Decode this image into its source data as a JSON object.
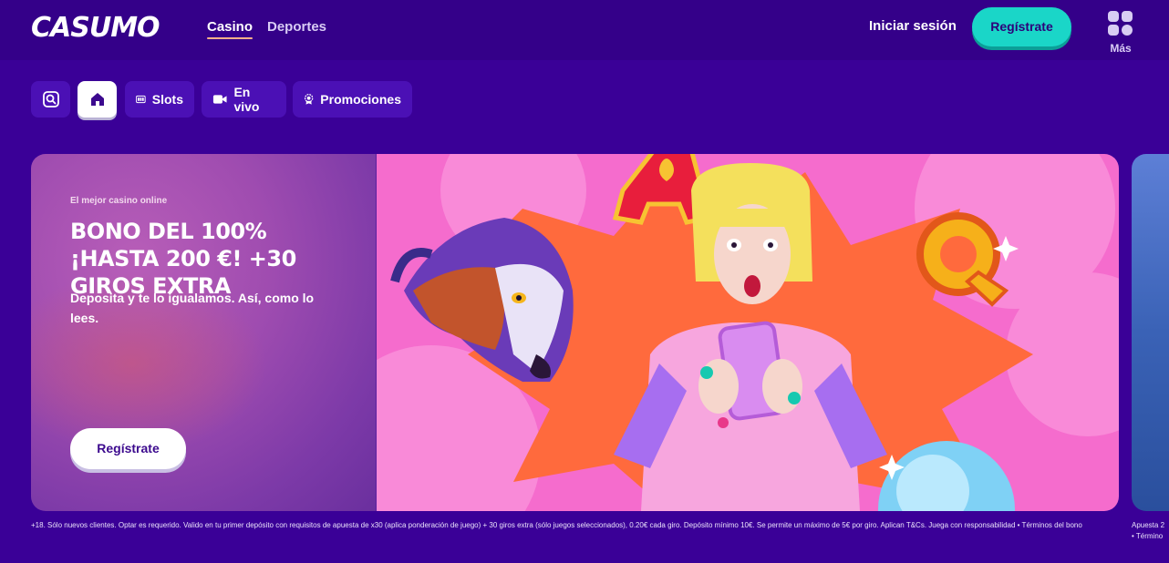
{
  "header": {
    "logo": "CASUMO",
    "tabs": [
      {
        "label": "Casino",
        "active": true
      },
      {
        "label": "Deportes",
        "active": false
      }
    ],
    "login_label": "Iniciar sesión",
    "register_label": "Regístrate",
    "more_label": "Más",
    "accent_color": "#1ad6c8"
  },
  "subnav": {
    "items": [
      {
        "label": "",
        "icon": "search-icon"
      },
      {
        "label": "",
        "icon": "home-icon",
        "active": true
      },
      {
        "label": "Slots",
        "icon": "slots-icon"
      },
      {
        "label": "En vivo",
        "icon": "video-camera-icon"
      },
      {
        "label": "Promociones",
        "icon": "badge-icon"
      }
    ]
  },
  "hero": {
    "eyebrow": "El mejor casino online",
    "title": "BONO DEL 100% ¡HASTA 200 €! +30 GIROS EXTRA",
    "subtitle": "Deposita y te lo igualamos. Así, como lo lees.",
    "cta_label": "Regístrate",
    "artwork_icons": [
      "wolf-illustration",
      "letter-a-symbol",
      "letter-q-symbol",
      "woman-with-phone-illustration",
      "crystal-ball-illustration"
    ]
  },
  "terms": {
    "text": "+18. Sólo nuevos clientes. Optar es requerido. Valido en tu primer depósito con requisitos de apuesta de x30 (aplica ponderación de juego) + 30 giros extra (sólo juegos seleccionados), 0.20€ cada giro. Depósito mínimo 10€. Se permite un máximo de 5€ por giro. Aplican T&Cs. Juega con responsabilidad • Términos del bono",
    "peek_line1": "Apuesta 2",
    "peek_line2": "• Término"
  }
}
